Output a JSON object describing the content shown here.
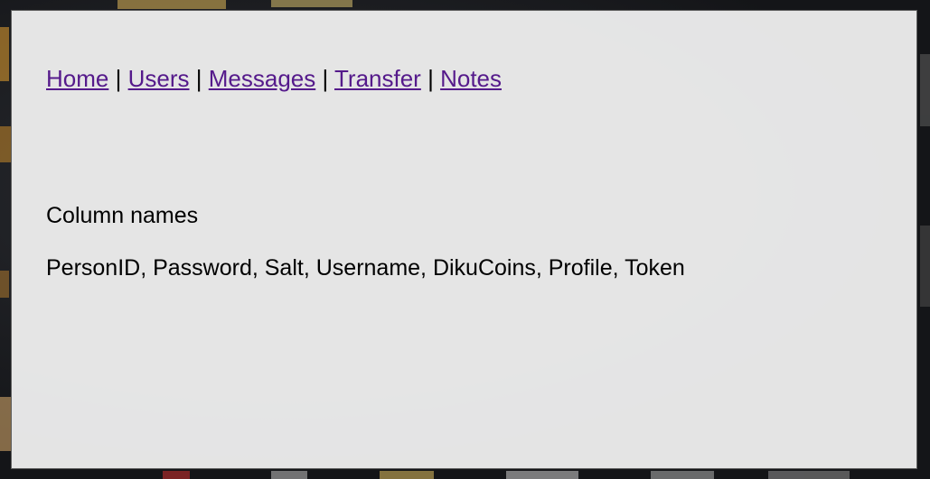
{
  "nav": {
    "links": [
      {
        "label": "Home"
      },
      {
        "label": "Users"
      },
      {
        "label": "Messages"
      },
      {
        "label": "Transfer"
      },
      {
        "label": "Notes"
      }
    ],
    "separator": "|"
  },
  "content": {
    "heading": "Column names",
    "columns": "PersonID, Password, Salt, Username, DikuCoins, Profile, Token"
  },
  "colors": {
    "link_visited": "#551a8b",
    "panel_bg": "#ececec",
    "page_bg": "#1c1d20"
  }
}
